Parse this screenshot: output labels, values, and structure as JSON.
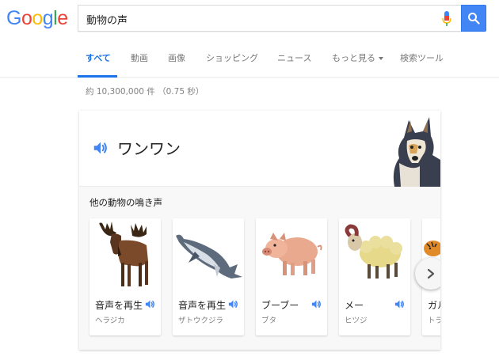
{
  "logo": {
    "text": [
      "G",
      "o",
      "o",
      "g",
      "l",
      "e"
    ]
  },
  "search": {
    "query": "動物の声"
  },
  "tabs": [
    {
      "label": "すべて",
      "active": true
    },
    {
      "label": "動画"
    },
    {
      "label": "画像"
    },
    {
      "label": "ショッピング"
    },
    {
      "label": "ニュース"
    },
    {
      "label": "もっと見る"
    },
    {
      "label": "検索ツール"
    }
  ],
  "result_stats": "約 10,300,000 件 （0.75 秒）",
  "card": {
    "main_sound": "ワンワン",
    "other_title": "他の動物の鳴き声",
    "animals": [
      {
        "label": "音声を再生",
        "sub": "ヘラジカ",
        "icon": "moose"
      },
      {
        "label": "音声を再生",
        "sub": "ザトウクジラ",
        "icon": "whale"
      },
      {
        "label": "ブーブー",
        "sub": "ブタ",
        "icon": "pig"
      },
      {
        "label": "メー",
        "sub": "ヒツジ",
        "icon": "sheep"
      },
      {
        "label": "ガル",
        "sub": "トラ",
        "icon": "tiger"
      }
    ]
  },
  "colors": {
    "accent": "#4285f4",
    "tab_active": "#1a73e8"
  }
}
